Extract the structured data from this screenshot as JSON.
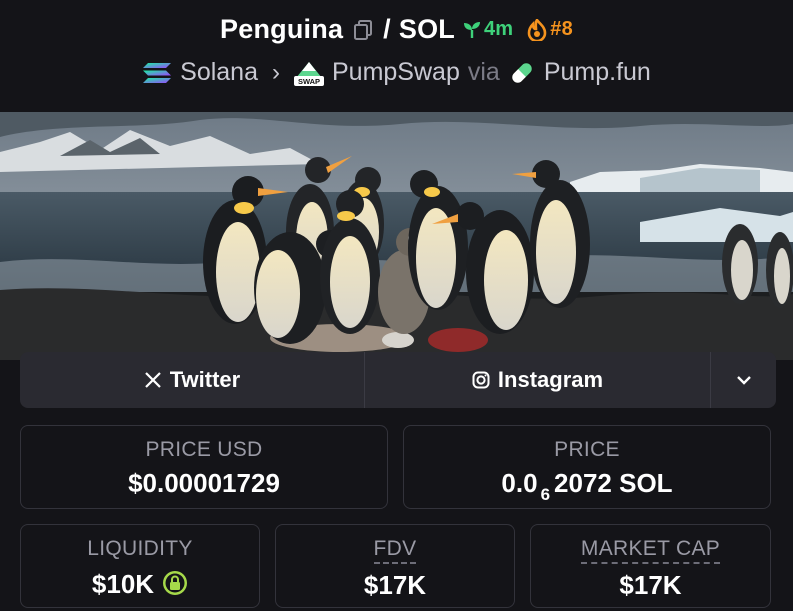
{
  "header": {
    "token_name": "Penguina",
    "separator": "/",
    "quote": "SOL",
    "age": "4m",
    "rank": "#8",
    "chain": "Solana",
    "dex": "PumpSwap",
    "via": "via",
    "launchpad": "Pump.fun",
    "dex_badge": "SWAP"
  },
  "icons": {
    "copy": "copy-icon",
    "age": "seedling-icon",
    "rank": "flame-icon",
    "chain": "solana-logo",
    "dex": "pumpswap-logo",
    "launchpad": "pill-icon",
    "twitter": "x-logo-icon",
    "instagram": "instagram-icon",
    "more": "chevron-down-icon",
    "liquidity_lock": "lock-icon"
  },
  "social": {
    "twitter_label": "Twitter",
    "instagram_label": "Instagram"
  },
  "stats": {
    "price_usd_label": "PRICE USD",
    "price_usd_value": "$0.00001729",
    "price_label": "PRICE",
    "price_prefix": "0.0",
    "price_zero_count": "6",
    "price_digits": "2072 SOL",
    "liquidity_label": "LIQUIDITY",
    "liquidity_value": "$10K",
    "fdv_label": "FDV",
    "fdv_value": "$17K",
    "mcap_label": "MARKET CAP",
    "mcap_value": "$17K"
  },
  "colors": {
    "background": "#141418",
    "panel": "#2a2a31",
    "age_green": "#3ed17a",
    "rank_orange": "#f5931e",
    "lock_green": "#a6d94a"
  }
}
